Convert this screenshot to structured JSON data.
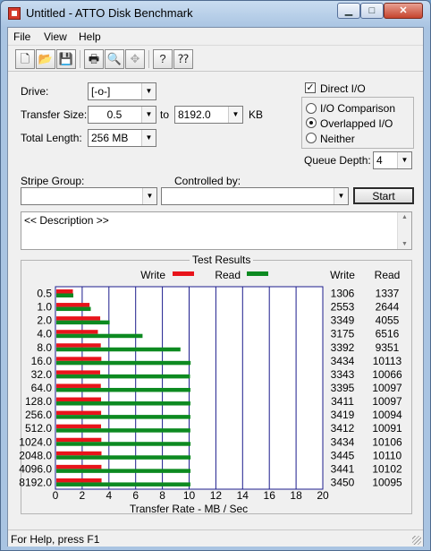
{
  "window": {
    "title": "Untitled - ATTO Disk Benchmark",
    "min_glyph": "▁",
    "max_glyph": "□",
    "close_glyph": "✕"
  },
  "menu": [
    {
      "label": "File"
    },
    {
      "label": "View"
    },
    {
      "label": "Help"
    }
  ],
  "toolbar": {
    "icons": [
      "new-file-icon",
      "open-folder-icon",
      "save-icon",
      "print-icon",
      "print-preview-icon",
      "move-icon",
      "help-icon",
      "context-help-icon"
    ],
    "glyphs": [
      "🗋",
      "📂",
      "💾",
      "🖶",
      "🔍",
      "✥",
      "?",
      "⁇"
    ]
  },
  "settings": {
    "drive_label": "Drive:",
    "drive_value": "[-o-]",
    "transfer_size_label": "Transfer Size:",
    "transfer_from": "0.5",
    "to_label": "to",
    "transfer_to": "8192.0",
    "kb_label": "KB",
    "total_length_label": "Total Length:",
    "total_length_value": "256 MB",
    "direct_io_label": "Direct I/O",
    "direct_io_checked": true,
    "io_options": [
      {
        "label": "I/O Comparison",
        "selected": false
      },
      {
        "label": "Overlapped I/O",
        "selected": true
      },
      {
        "label": "Neither",
        "selected": false
      }
    ],
    "queue_depth_label": "Queue Depth:",
    "queue_depth_value": "4",
    "stripe_group_label": "Stripe Group:",
    "stripe_group_value": "",
    "controlled_by_label": "Controlled by:",
    "controlled_by_value": "",
    "start_label": "Start",
    "description": "<< Description >>"
  },
  "results": {
    "title": "Test Results",
    "write_legend": "Write",
    "read_legend": "Read",
    "write_col": "Write",
    "read_col": "Read",
    "colors": {
      "write": "#e8141b",
      "read": "#0d8a21",
      "grid": "#1c1c8c"
    }
  },
  "chart_data": {
    "type": "bar",
    "orientation": "horizontal",
    "title": "Test Results",
    "xlabel": "Transfer Rate - MB / Sec",
    "xlim": [
      0,
      20
    ],
    "xticks": [
      0,
      2,
      4,
      6,
      8,
      10,
      12,
      14,
      16,
      18,
      20
    ],
    "grid": true,
    "categories": [
      "0.5",
      "1.0",
      "2.0",
      "4.0",
      "8.0",
      "16.0",
      "32.0",
      "64.0",
      "128.0",
      "256.0",
      "512.0",
      "1024.0",
      "2048.0",
      "4096.0",
      "8192.0"
    ],
    "series": [
      {
        "name": "Write",
        "color": "#e8141b",
        "values": [
          1.306,
          2.553,
          3.349,
          3.175,
          3.392,
          3.434,
          3.343,
          3.395,
          3.411,
          3.419,
          3.412,
          3.434,
          3.445,
          3.441,
          3.45
        ]
      },
      {
        "name": "Read",
        "color": "#0d8a21",
        "values": [
          1.337,
          2.644,
          4.055,
          6.516,
          9.351,
          10.113,
          10.066,
          10.097,
          10.097,
          10.094,
          10.091,
          10.106,
          10.11,
          10.102,
          10.095
        ]
      }
    ],
    "table": {
      "write": [
        "1306",
        "2553",
        "3349",
        "3175",
        "3392",
        "3434",
        "3343",
        "3395",
        "3411",
        "3419",
        "3412",
        "3434",
        "3445",
        "3441",
        "3450"
      ],
      "read": [
        "1337",
        "2644",
        "4055",
        "6516",
        "9351",
        "10113",
        "10066",
        "10097",
        "10097",
        "10094",
        "10091",
        "10106",
        "10110",
        "10102",
        "10095"
      ]
    }
  },
  "status": {
    "text": "For Help, press F1"
  }
}
